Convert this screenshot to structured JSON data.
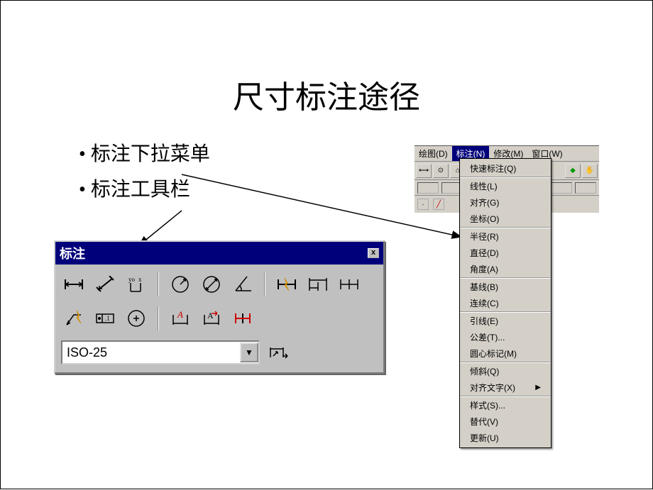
{
  "title": "尺寸标注途径",
  "bullets": [
    "标注下拉菜单",
    "标注工具栏"
  ],
  "toolbar": {
    "title": "标注",
    "close": "x",
    "style_value": "ISO-25",
    "icons_row1": [
      "linear-dim-icon",
      "aligned-dim-icon",
      "ordinate-dim-icon",
      "radius-dim-icon",
      "diameter-dim-icon",
      "angular-dim-icon",
      "quick-dim-icon",
      "baseline-dim-icon",
      "continue-dim-icon"
    ],
    "icons_row2": [
      "qleader-icon",
      "tolerance-icon",
      "center-mark-icon",
      "dim-edit-icon",
      "dim-text-edit-icon",
      "dim-override-icon"
    ],
    "dim_update_icon": "dim-update-icon"
  },
  "menubar": {
    "items": [
      "绘图(D)",
      "标注(N)",
      "修改(M)",
      "窗口(W)"
    ],
    "active_index": 1
  },
  "dropdown": {
    "groups": [
      [
        "快速标注(Q)"
      ],
      [
        "线性(L)",
        "对齐(G)",
        "坐标(O)"
      ],
      [
        "半径(R)",
        "直径(D)",
        "角度(A)"
      ],
      [
        "基线(B)",
        "连续(C)"
      ],
      [
        "引线(E)",
        "公差(T)...",
        "圆心标记(M)"
      ],
      [
        "倾斜(Q)",
        "对齐文字(X)"
      ],
      [
        "样式(S)...",
        "替代(V)",
        "更新(U)"
      ]
    ],
    "submenu_index": [
      5,
      1
    ]
  }
}
